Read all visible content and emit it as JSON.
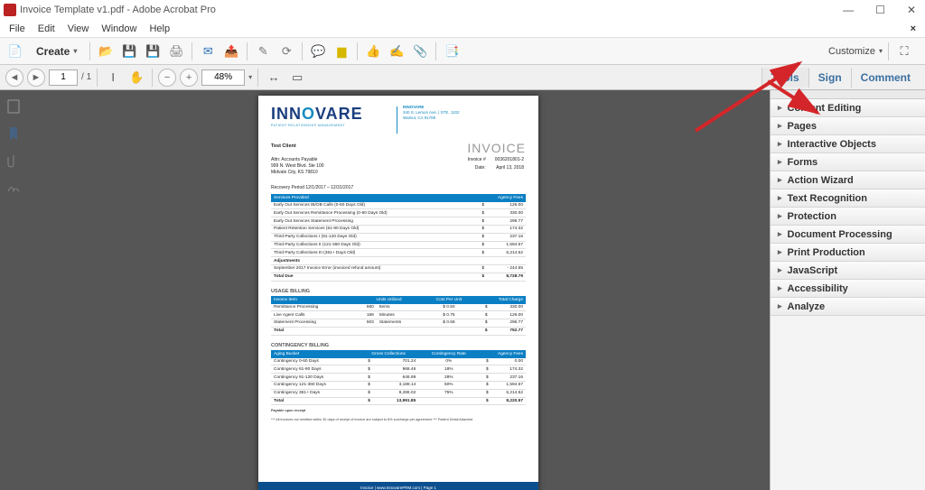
{
  "window": {
    "title": "Invoice Template v1.pdf - Adobe Acrobat Pro"
  },
  "menubar": [
    "File",
    "Edit",
    "View",
    "Window",
    "Help"
  ],
  "toolbar": {
    "create": "Create",
    "customize": "Customize"
  },
  "nav": {
    "page_current": "1",
    "page_total": "1",
    "zoom": "48%"
  },
  "tabs": {
    "tools": "Tools",
    "sign": "Sign",
    "comment": "Comment"
  },
  "right_panel": [
    "Content Editing",
    "Pages",
    "Interactive Objects",
    "Forms",
    "Action Wizard",
    "Text Recognition",
    "Protection",
    "Document Processing",
    "Print Production",
    "JavaScript",
    "Accessibility",
    "Analyze"
  ],
  "doc": {
    "logo": {
      "pre": "INN",
      "o": "O",
      "post": "VARE",
      "sub": "PATIENT RELATIONSHIP MANAGEMENT"
    },
    "company": {
      "name": "INNOVARE",
      "addr1": "340 S. Lemon Ave. | STE. 1102",
      "addr2": "Walnut, CA 91789"
    },
    "invoice_title": "INVOICE",
    "client": {
      "name": "Test Client",
      "attn": "Attn: Accounts Payable",
      "addr1": "999 N. West Blvd. Ste 100",
      "addr2": "Midvale City, KS 79810"
    },
    "meta": {
      "invno_lbl": "Invoice #",
      "invno": "0036201801-2",
      "date_lbl": "Date:",
      "date": "April 13, 2018"
    },
    "recovery": "Recovery Period 12/1/2017 – 12/31/2017",
    "services": {
      "head": [
        "Services Provided",
        "Agency Fees"
      ],
      "rows": [
        [
          "Early Out Services IB/OB Calls (0-60 Days Old)",
          "$",
          "126.00"
        ],
        [
          "Early Out Services Remittance Processing (0-60 Days Old)",
          "$",
          "330.00"
        ],
        [
          "Early Out Services Statement Processing",
          "$",
          "296.77"
        ],
        [
          "Patient Retention Services (61-90 Days Old)",
          "$",
          "174.32"
        ],
        [
          "Third-Party Collections I (91-120 Days Old)",
          "$",
          "237.16"
        ],
        [
          "Third-Party Collections II (121-360 Days Old)",
          "$",
          "1,594.57"
        ],
        [
          "Third-Party Collections III (361+ Days Old)",
          "$",
          "6,214.52"
        ]
      ],
      "adj_label": "Adjustments",
      "adj": [
        [
          "September 2017 Invoice Error (invoiced refund amount)",
          "$",
          "- 244.55"
        ]
      ],
      "total": [
        "Total Due",
        "$",
        "8,728.79"
      ]
    },
    "usage": {
      "title": "USAGE BILLING",
      "head": [
        "Invoice Item",
        "Units Utilized",
        "",
        "Cost Per Unit",
        "Total Charge"
      ],
      "rows": [
        [
          "Remittance Processing",
          "660",
          "Items",
          "$   0.50",
          "$",
          "330.00"
        ],
        [
          "Live Agent Calls",
          "168",
          "Minutes",
          "$   0.75",
          "$",
          "126.00"
        ],
        [
          "Statement Processing",
          "503",
          "Statements",
          "$   0.59",
          "$",
          "296.77"
        ]
      ],
      "total": [
        "Total",
        "",
        "",
        "",
        "$",
        "752.77"
      ]
    },
    "contingency": {
      "title": "CONTINGENCY BILLING",
      "head": [
        "Aging Bucket",
        "Gross Collections",
        "Contingency Rate",
        "Agency Fees"
      ],
      "rows": [
        [
          "Contingency 0-60 Days",
          "$",
          "701.24",
          "0%",
          "$",
          "0.00"
        ],
        [
          "Contingency 61-90 Days",
          "$",
          "968.46",
          "18%",
          "$",
          "174.32"
        ],
        [
          "Contingency 91-120 Days",
          "$",
          "646.99",
          "28%",
          "$",
          "237.16"
        ],
        [
          "Contingency 121-360 Days",
          "$",
          "3,189.14",
          "50%",
          "$",
          "1,594.57"
        ],
        [
          "Contingency 361+ Days",
          "$",
          "8,286.02",
          "75%",
          "$",
          "6,214.52"
        ]
      ],
      "total": [
        "Total",
        "$",
        "13,991.85",
        "",
        "$",
        "8,220.57"
      ]
    },
    "payable": "Payable upon receipt",
    "fine": "*** All invoices not remitted within 30 days of receipt of invoice are subject to 8% surcharge per agreement *** Patient Detail Attached",
    "footer": "Invoice | www.InnovarePRM.com | Page 1"
  }
}
